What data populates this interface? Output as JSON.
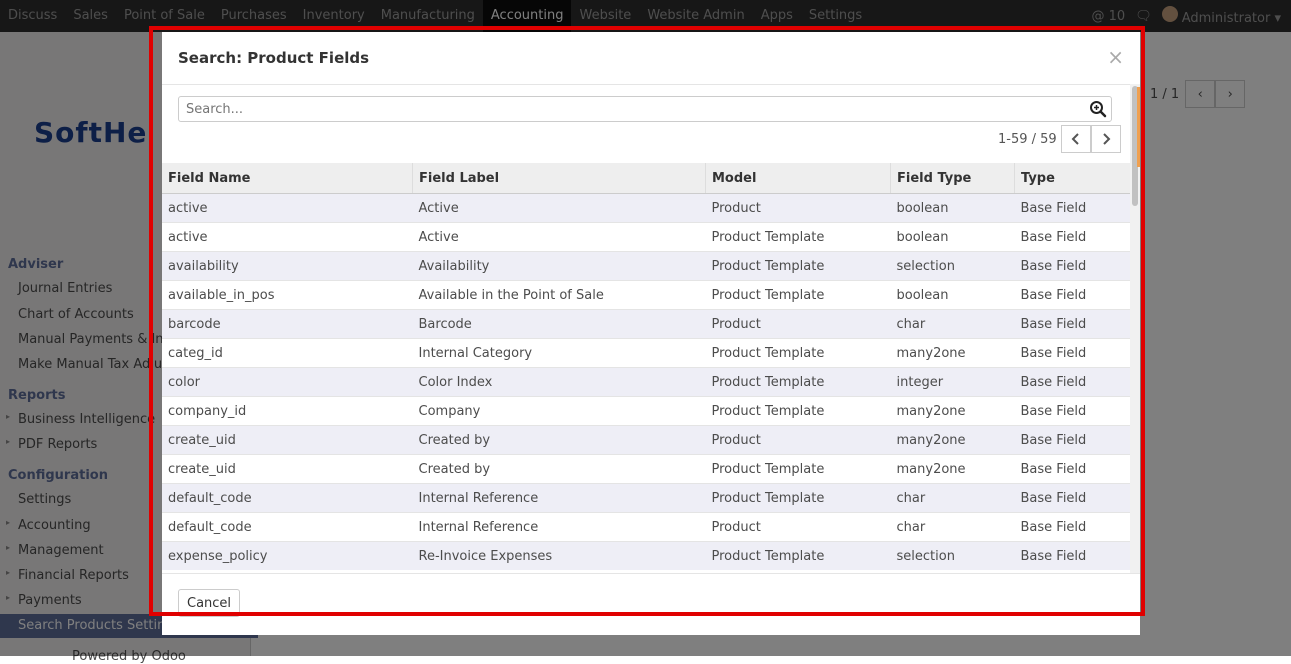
{
  "topbar": {
    "menu": [
      "Discuss",
      "Sales",
      "Point of Sale",
      "Purchases",
      "Inventory",
      "Manufacturing",
      "Accounting",
      "Website",
      "Website Admin",
      "Apps",
      "Settings"
    ],
    "active": "Accounting",
    "notifications": "10",
    "user": "Administrator"
  },
  "sidebar": {
    "logo": "SoftHe",
    "section_adviser": "Adviser",
    "adviser_items": [
      "Journal Entries",
      "Chart of Accounts",
      "Manual Payments & Invo",
      "Make Manual Tax Adjust"
    ],
    "section_reports": "Reports",
    "reports_items": [
      "Business Intelligence",
      "PDF Reports"
    ],
    "section_config": "Configuration",
    "config_items": [
      "Settings",
      "Accounting",
      "Management",
      "Financial Reports",
      "Payments",
      "Search Products Setting"
    ],
    "powered": "Powered by Odoo"
  },
  "control_panel": {
    "pager": "1 / 1"
  },
  "dialog": {
    "title": "Search: Product Fields",
    "close": "×",
    "search_placeholder": "Search...",
    "pager_value": "1-59 / 59",
    "columns": [
      "Field Name",
      "Field Label",
      "Model",
      "Field Type",
      "Type"
    ],
    "rows": [
      [
        "active",
        "Active",
        "Product",
        "boolean",
        "Base Field"
      ],
      [
        "active",
        "Active",
        "Product Template",
        "boolean",
        "Base Field"
      ],
      [
        "availability",
        "Availability",
        "Product Template",
        "selection",
        "Base Field"
      ],
      [
        "available_in_pos",
        "Available in the Point of Sale",
        "Product Template",
        "boolean",
        "Base Field"
      ],
      [
        "barcode",
        "Barcode",
        "Product",
        "char",
        "Base Field"
      ],
      [
        "categ_id",
        "Internal Category",
        "Product Template",
        "many2one",
        "Base Field"
      ],
      [
        "color",
        "Color Index",
        "Product Template",
        "integer",
        "Base Field"
      ],
      [
        "company_id",
        "Company",
        "Product Template",
        "many2one",
        "Base Field"
      ],
      [
        "create_uid",
        "Created by",
        "Product",
        "many2one",
        "Base Field"
      ],
      [
        "create_uid",
        "Created by",
        "Product Template",
        "many2one",
        "Base Field"
      ],
      [
        "default_code",
        "Internal Reference",
        "Product Template",
        "char",
        "Base Field"
      ],
      [
        "default_code",
        "Internal Reference",
        "Product",
        "char",
        "Base Field"
      ],
      [
        "expense_policy",
        "Re-Invoice Expenses",
        "Product Template",
        "selection",
        "Base Field"
      ]
    ],
    "cancel_label": "Cancel"
  }
}
